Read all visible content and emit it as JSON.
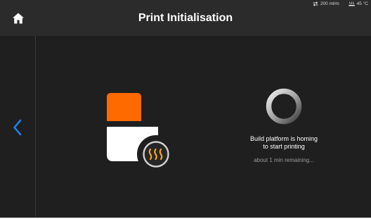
{
  "header": {
    "title": "Print Initialisation",
    "home_icon": "home-icon"
  },
  "status_bar": {
    "flow_icon": "swap-arrows-icon",
    "flow_value": "200 ml/m",
    "temp_icon": "heat-bed-icon",
    "temp_value": "45 °C"
  },
  "nav": {
    "back_icon": "chevron-left-icon"
  },
  "main": {
    "illustration": "build-platform-heating-icon",
    "spinner": "loading-spinner",
    "message_line1": "Build platform is homing",
    "message_line2": "to start printing",
    "time_remaining": "about 1 min remaining..."
  },
  "colors": {
    "accent_orange": "#ff6a00",
    "accent_blue": "#1e7fe6",
    "heater_yellow": "#f5a623",
    "background": "#1f1f1f",
    "header_background": "#2b2b2b"
  }
}
